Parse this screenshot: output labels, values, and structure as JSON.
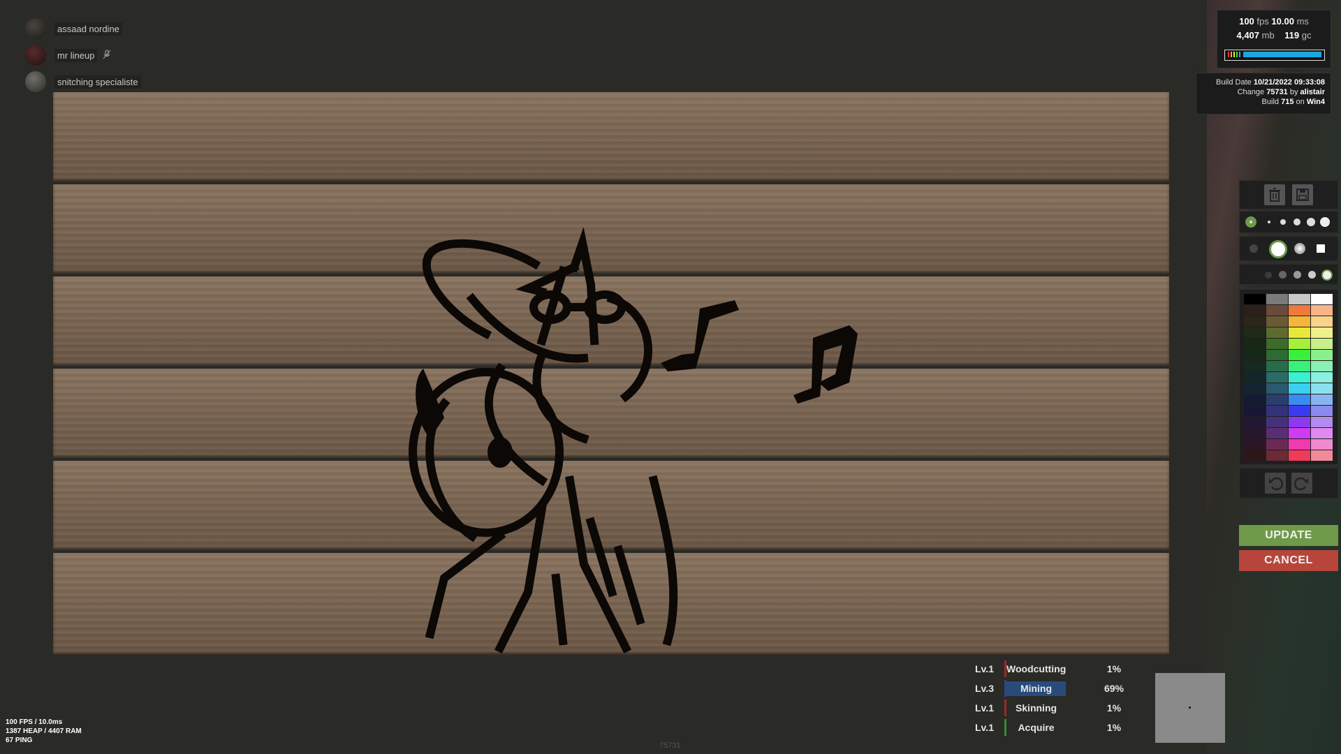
{
  "team": [
    {
      "name": "assaad nordine",
      "avatar": "avatar"
    },
    {
      "name": "mr lineup",
      "avatar": "avatar-red",
      "icon": "mic-muted-icon"
    },
    {
      "name": "snitching specialiste",
      "avatar": "avatar-grey"
    }
  ],
  "perf": {
    "fps": "100",
    "fps_unit": "fps",
    "ms": "10.00",
    "ms_unit": "ms",
    "mem": "4,407",
    "mem_unit": "mb",
    "gc": "119",
    "gc_unit": "gc"
  },
  "build": {
    "date_label": "Build Date",
    "date": "10/21/2022 09:33:08",
    "change_label": "Change",
    "change": "75731",
    "by_label": "by",
    "author": "alistair",
    "build_label": "Build",
    "build_num": "715",
    "on_label": "on",
    "machine": "Win4"
  },
  "paint_panel": {
    "tools": [
      "trash-icon",
      "save-icon"
    ],
    "undo_icon": "undo-icon",
    "redo_icon": "redo-icon",
    "update_label": "UPDATE",
    "cancel_label": "CANCEL",
    "palette_columns": [
      [
        "#000000",
        "#2b201b",
        "#2a261a",
        "#1f2a17",
        "#182716",
        "#162817",
        "#152a21",
        "#132729",
        "#142431",
        "#141a32",
        "#181634",
        "#211833",
        "#28172e",
        "#2c1525",
        "#2e1519"
      ],
      [
        "#7a7a7a",
        "#6b4a3a",
        "#6b5a36",
        "#5e6b2e",
        "#3d6b2a",
        "#2d6b33",
        "#2a6b4a",
        "#2a6b66",
        "#2a5a6e",
        "#2a3e6e",
        "#33327a",
        "#46307a",
        "#5a2e72",
        "#6b2a55",
        "#6b2a36"
      ],
      [
        "#c8c8c8",
        "#f07a3a",
        "#f5b53a",
        "#e8e83a",
        "#a4f03a",
        "#3af03a",
        "#3af07a",
        "#3af0d0",
        "#3ad0f0",
        "#3a8cf0",
        "#3a3af0",
        "#8c3af0",
        "#d03af0",
        "#f03ab0",
        "#f03a5a"
      ],
      [
        "#ffffff",
        "#f7b48a",
        "#f7d48a",
        "#f0f08a",
        "#c8f08a",
        "#8af08a",
        "#8af0b4",
        "#8af0e0",
        "#8ae0f0",
        "#8ab4f0",
        "#8a8af0",
        "#b48af0",
        "#e08af0",
        "#f08ad0",
        "#f08a9a"
      ]
    ]
  },
  "skills": [
    {
      "level": "Lv.1",
      "name": "Woodcutting",
      "percent": "1%",
      "progress": 0.01,
      "color": "#9a2a2a"
    },
    {
      "level": "Lv.3",
      "name": "Mining",
      "percent": "69%",
      "progress": 0.69,
      "color": "#284b7c"
    },
    {
      "level": "Lv.1",
      "name": "Skinning",
      "percent": "1%",
      "progress": 0.01,
      "color": "#9a2a2a"
    },
    {
      "level": "Lv.1",
      "name": "Acquire",
      "percent": "1%",
      "progress": 0.01,
      "color": "#3a8a3a"
    }
  ],
  "fps_overlay": {
    "line1": "100 FPS / 10.0ms",
    "line2": "1387 HEAP / 4407 RAM",
    "line3": "67 PING"
  },
  "build_watermark": "75731"
}
